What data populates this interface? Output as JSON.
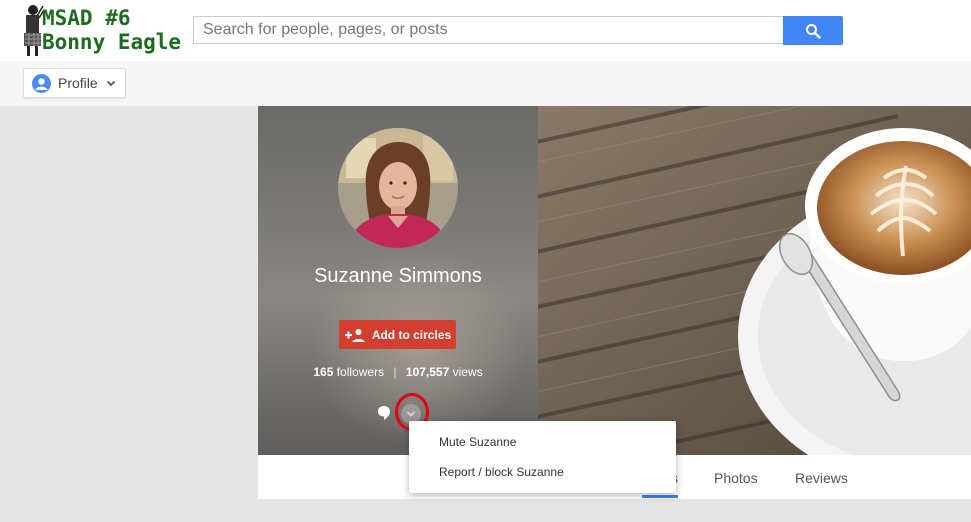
{
  "logo": {
    "line1": "MSAD #6",
    "line2": "Bonny Eagle"
  },
  "search": {
    "placeholder": "Search for people, pages, or posts"
  },
  "nav": {
    "profile_label": "Profile"
  },
  "profile": {
    "name": "Suzanne Simmons",
    "add_label": "Add to circles",
    "followers_count": "165",
    "followers_label": "followers",
    "views_count": "107,557",
    "views_label": "views"
  },
  "menu": {
    "items": [
      "Mute Suzanne",
      "Report / block Suzanne"
    ]
  },
  "tabs": {
    "photos": "Photos",
    "reviews": "Reviews",
    "partial": "s"
  },
  "colors": {
    "accent": "#4285f4",
    "add_button": "#d23f31",
    "highlight": "#e4000f",
    "logo_green": "#1e6b1e"
  },
  "icons": [
    "search-icon",
    "profile-avatar-icon",
    "chevron-down-icon",
    "add-person-icon",
    "comment-icon"
  ]
}
